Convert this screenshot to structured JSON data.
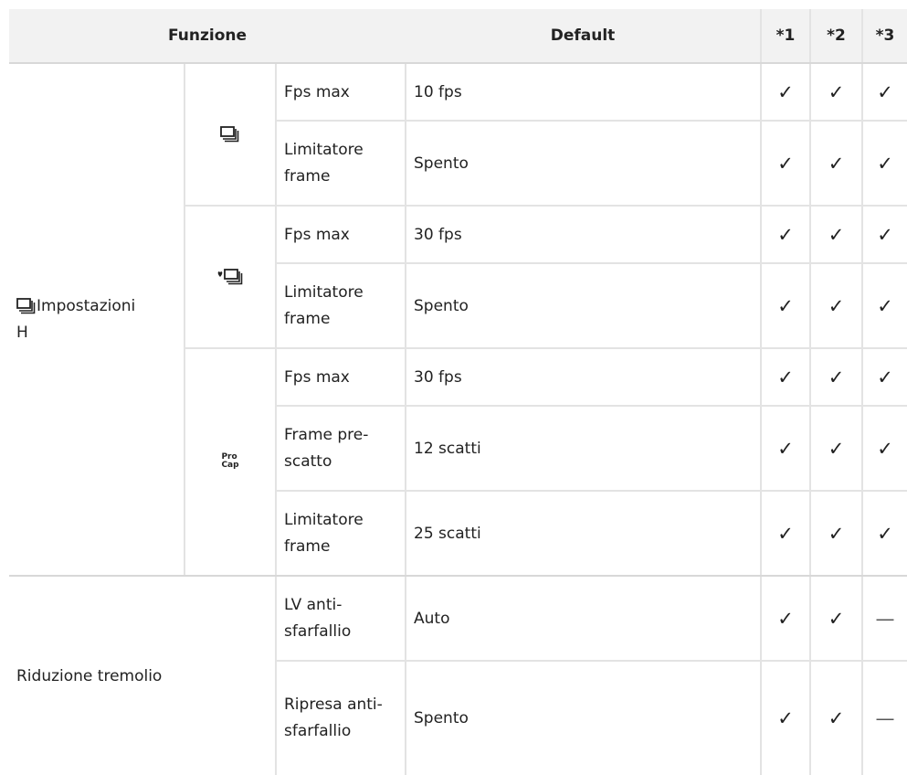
{
  "header": {
    "funzione": "Funzione",
    "default": "Default",
    "c1": "*1",
    "c2": "*2",
    "c3": "*3"
  },
  "marks": {
    "check": "✓",
    "dash": "—"
  },
  "group1": {
    "label_text": "Impostazioni",
    "label_suffix": "H",
    "icon_names": [
      "sequential-shooting-icon",
      "silent-sequential-shooting-icon",
      "pro-capture-icon"
    ],
    "procap": {
      "line1": "Pro",
      "line2": "Cap"
    },
    "rows": [
      {
        "name": "Fps max",
        "value": "10 fps",
        "marks": [
          "✓",
          "✓",
          "✓"
        ]
      },
      {
        "name": "Limitatore frame",
        "value": "Spento",
        "marks": [
          "✓",
          "✓",
          "✓"
        ]
      },
      {
        "name": "Fps max",
        "value": "30 fps",
        "marks": [
          "✓",
          "✓",
          "✓"
        ]
      },
      {
        "name": "Limitatore frame",
        "value": "Spento",
        "marks": [
          "✓",
          "✓",
          "✓"
        ]
      },
      {
        "name": "Fps max",
        "value": "30 fps",
        "marks": [
          "✓",
          "✓",
          "✓"
        ]
      },
      {
        "name": "Frame pre-scatto",
        "value": "12 scatti",
        "marks": [
          "✓",
          "✓",
          "✓"
        ]
      },
      {
        "name": "Limitatore frame",
        "value": "25 scatti",
        "marks": [
          "✓",
          "✓",
          "✓"
        ]
      }
    ]
  },
  "group2": {
    "label": "Riduzione tremolio",
    "rows": [
      {
        "name": "LV anti-sfarfallio",
        "value": "Auto",
        "marks": [
          "✓",
          "✓",
          "—"
        ]
      },
      {
        "name": "Ripresa anti-sfarfallio",
        "value": "Spento",
        "marks": [
          "✓",
          "✓",
          "—"
        ]
      }
    ]
  }
}
